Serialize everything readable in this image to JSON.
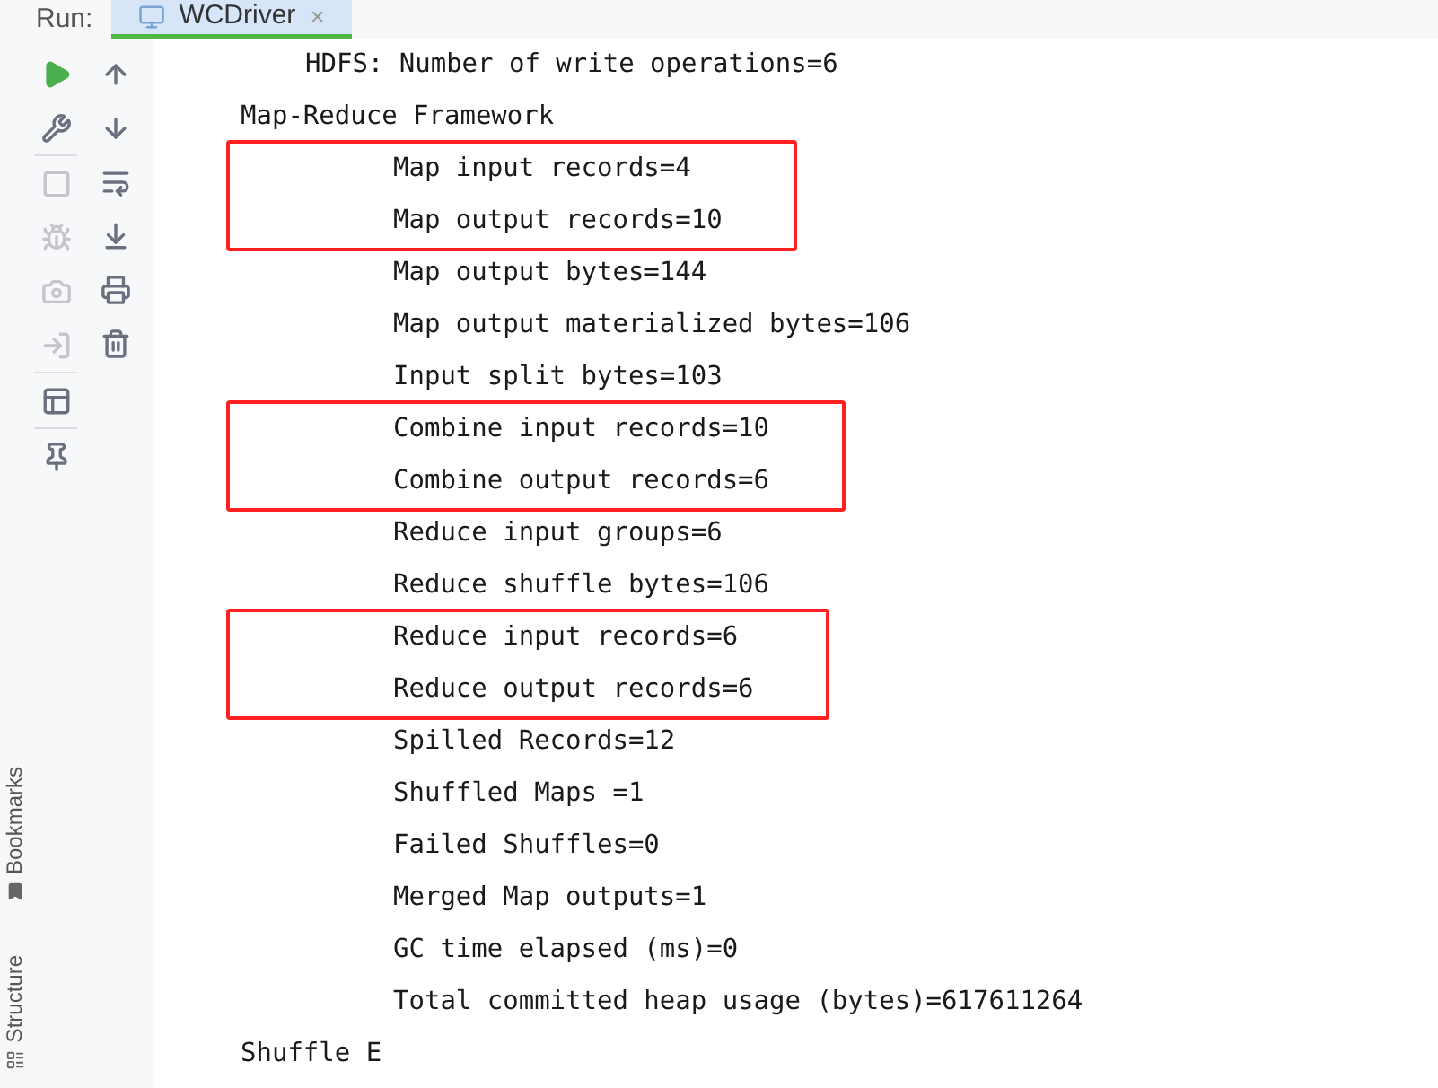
{
  "run_bar": {
    "label": "Run:",
    "tabs": [
      {
        "label": "WCDriver",
        "close": "×",
        "selected": true
      }
    ]
  },
  "toolbar_primary": [
    {
      "kind": "run",
      "disabled": false
    },
    {
      "kind": "settings",
      "disabled": false
    },
    {
      "kind": "stop",
      "disabled": true
    },
    {
      "kind": "debug",
      "disabled": true
    },
    {
      "kind": "camera",
      "disabled": true
    },
    {
      "kind": "login",
      "disabled": true
    },
    {
      "kind": "layout",
      "disabled": false
    },
    {
      "kind": "pin",
      "disabled": false
    }
  ],
  "toolbar_secondary": [
    {
      "kind": "up",
      "disabled": false
    },
    {
      "kind": "down",
      "disabled": false
    },
    {
      "kind": "wrap",
      "disabled": false
    },
    {
      "kind": "scroll-end",
      "disabled": false
    },
    {
      "kind": "print",
      "disabled": false
    },
    {
      "kind": "trash",
      "disabled": false
    }
  ],
  "side_tabs": [
    {
      "label": "Bookmarks"
    },
    {
      "label": "Structure"
    }
  ],
  "console": {
    "leading": [
      "HDFS: Number of write operations=6"
    ],
    "groups": [
      {
        "title": "Map-Reduce Framework",
        "children": [
          {
            "kind": "highlight",
            "children": [
              "Map input records=4",
              "Map output records=10"
            ]
          },
          {
            "kind": "line",
            "text": "Map output bytes=144"
          },
          {
            "kind": "line",
            "text": "Map output materialized bytes=106"
          },
          {
            "kind": "line",
            "text": "Input split bytes=103"
          },
          {
            "kind": "highlight",
            "children": [
              "Combine input records=10",
              "Combine output records=6"
            ]
          },
          {
            "kind": "line",
            "text": "Reduce input groups=6"
          },
          {
            "kind": "line",
            "text": "Reduce shuffle bytes=106"
          },
          {
            "kind": "highlight",
            "children": [
              "Reduce input records=6",
              "Reduce output records=6"
            ]
          },
          {
            "kind": "line",
            "text": "Spilled Records=12"
          },
          {
            "kind": "line",
            "text": "Shuffled Maps =1"
          },
          {
            "kind": "line",
            "text": "Failed Shuffles=0"
          },
          {
            "kind": "line",
            "text": "Merged Map outputs=1"
          },
          {
            "kind": "line",
            "text": "GC time elapsed (ms)=0"
          },
          {
            "kind": "line",
            "text": "Total committed heap usage (bytes)=617611264"
          }
        ]
      },
      {
        "title": "Shuffle E"
      }
    ]
  }
}
